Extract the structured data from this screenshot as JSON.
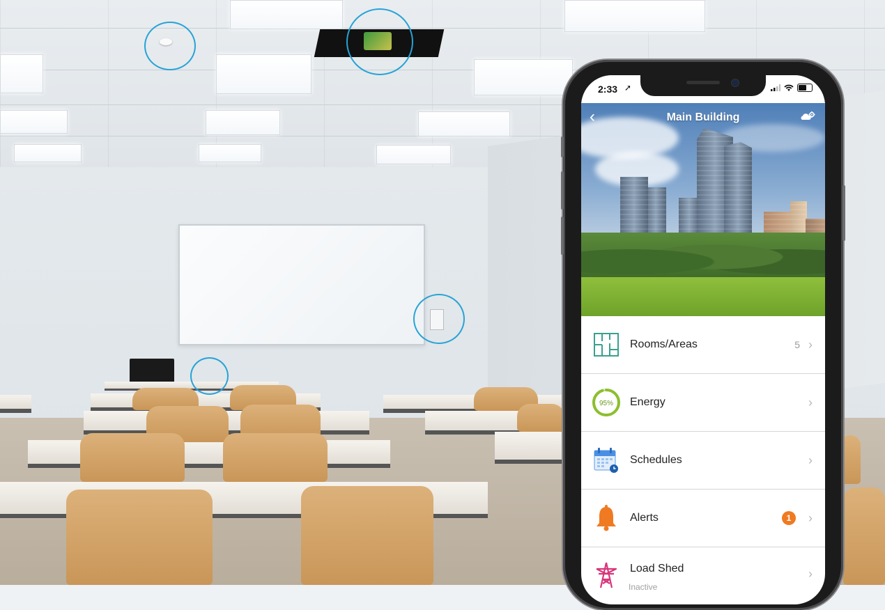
{
  "status_bar": {
    "time": "2:33"
  },
  "header": {
    "title": "Main Building"
  },
  "menu": {
    "items": [
      {
        "label": "Rooms/Areas",
        "count": "5",
        "icon": "floorplan-icon"
      },
      {
        "label": "Energy",
        "ring_label": "95%",
        "percent": 95,
        "icon": "energy-ring-icon"
      },
      {
        "label": "Schedules",
        "icon": "calendar-clock-icon"
      },
      {
        "label": "Alerts",
        "badge": "1",
        "icon": "bell-icon"
      },
      {
        "label": "Load Shed",
        "status": "Inactive",
        "icon": "power-tower-icon"
      }
    ]
  },
  "colors": {
    "accent_ring": "#27a3d6",
    "badge": "#f07a22",
    "energy_ring": "#8cbf2f",
    "teal": "#3aa08f",
    "alert": "#f07a22",
    "load_shed": "#d8357a"
  }
}
